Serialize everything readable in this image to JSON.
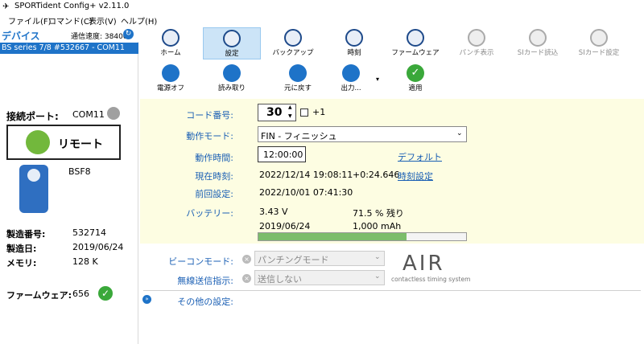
{
  "window": {
    "title": "SPORTident Config+ v2.11.0"
  },
  "menu": [
    "ファイル(F)",
    "コマンド(C)",
    "表示(V)",
    "ヘルプ(H)"
  ],
  "devices": {
    "header": "デバイス",
    "speed_label": "通信速度: 38400",
    "selected": "BS series 7/8 #532667 - COM11"
  },
  "connection": {
    "port_label": "接続ポート:",
    "port_value": "COM11",
    "remote_label": "リモート"
  },
  "device_info": {
    "model": "BSF8",
    "serial_label": "製造番号:",
    "serial_value": "532714",
    "date_label": "製造日:",
    "date_value": "2019/06/24",
    "memory_label": "メモリ:",
    "memory_value": "128 K",
    "firmware_label": "ファームウェア:",
    "firmware_value": "656"
  },
  "toolbar": {
    "row1": [
      "ホーム",
      "設定",
      "バックアップ",
      "時刻",
      "ファームウェア",
      "パンチ表示",
      "SIカード読込",
      "SIカード設定"
    ],
    "row2": [
      "電源オフ",
      "読み取り",
      "元に戻す",
      "出力...",
      "適用"
    ]
  },
  "settings": {
    "code_label": "コード番号:",
    "code_value": "30",
    "plus_one": "+1",
    "mode_label": "動作モード:",
    "mode_value": "FIN - フィニッシュ",
    "optime_label": "動作時間:",
    "optime_value": "12:00:00",
    "default_link": "デフォルト",
    "curtime_label": "現在時刻:",
    "curtime_value": "2022/12/14 19:08:11",
    "offset_value": "+0:24.646",
    "timeset_link": "時刻設定",
    "last_label": "前回設定:",
    "last_value": "2022/10/01 07:41:30",
    "battery_label": "バッテリー:",
    "battery_voltage": "3.43 V",
    "battery_percent": "71.5 % 残り",
    "battery_date": "2019/06/24",
    "battery_capacity": "1,000 mAh",
    "battery_fill": 0.715
  },
  "lower": {
    "beacon_label": "ビーコンモード:",
    "beacon_value": "パンチングモード",
    "wireless_label": "無線送信指示:",
    "wireless_value": "送信しない",
    "air_logo": "AIR",
    "air_tagline": "contactless timing system",
    "more_label": "その他の設定:"
  },
  "colors": {
    "accent": "#1e73c8",
    "label": "#1a5fb4",
    "battery": "#7cbd6b",
    "panel": "#fdfde2",
    "ok_green": "#3aa83a"
  }
}
